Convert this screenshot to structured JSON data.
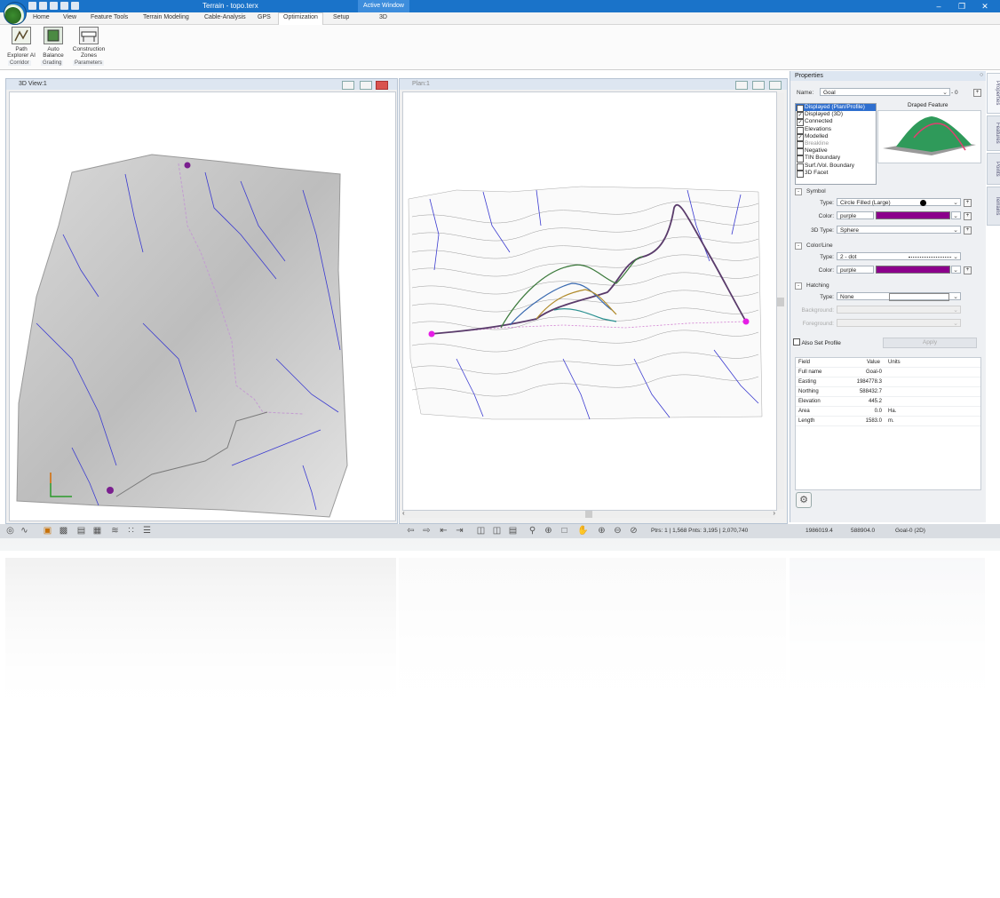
{
  "app": {
    "title": "Terrain - topo.terx",
    "active_window_label": "Active Window",
    "context_tab": "3D",
    "accent": "#1a73c9"
  },
  "menu": [
    "Home",
    "View",
    "Feature Tools",
    "Terrain Modeling",
    "Cable-Analysis",
    "GPS",
    "Optimization",
    "Setup"
  ],
  "menu_active": "Optimization",
  "ribbon": {
    "buttons": [
      {
        "label": "Path Explorer AI",
        "line1": "Path",
        "line2": "Explorer AI",
        "icon": "path-explorer-icon"
      },
      {
        "label": "Auto Balance",
        "line1": "Auto",
        "line2": "Balance",
        "icon": "auto-balance-icon"
      },
      {
        "label": "Construction Zones",
        "line1": "Construction",
        "line2": "Zones",
        "icon": "construction-zones-icon"
      }
    ],
    "groups": [
      "Corridor",
      "Grading",
      "Parameters"
    ]
  },
  "view3d": {
    "title": "3D View:1"
  },
  "plan": {
    "title": "Plan:1"
  },
  "status": {
    "counts": "Ptrs: 1 | 1,568  Pnts: 3,195 | 2,070,740",
    "easting": "1986019.4",
    "northing": "588904.0",
    "feature": "Goal-0 (2D)"
  },
  "properties": {
    "title": "Properties",
    "name_label": "Name:",
    "name_value": "Goal",
    "name_suffix": "- 0",
    "preview_label": "Draped Feature",
    "checks": [
      {
        "label": "Displayed (Plan/Profile)",
        "checked": true,
        "selected": true
      },
      {
        "label": "Displayed (3D)",
        "checked": true
      },
      {
        "label": "Connected",
        "checked": true
      },
      {
        "label": "Elevations",
        "checked": false
      },
      {
        "label": "Modelled",
        "checked": true
      },
      {
        "label": "Breakline",
        "checked": false,
        "dim": true
      },
      {
        "label": "Negative",
        "checked": false
      },
      {
        "label": "TIN Boundary",
        "checked": false
      },
      {
        "label": "Surf./Vol. Boundary",
        "checked": false
      },
      {
        "label": "3D Facet",
        "checked": false
      }
    ],
    "symbol": {
      "section": "Symbol",
      "type_label": "Type:",
      "type_value": "Circle Filled (Large)",
      "color_label": "Color:",
      "color_value": "purple",
      "color_hex": "#8b008b",
      "type3d_label": "3D Type:",
      "type3d_value": "Sphere"
    },
    "colorline": {
      "section": "Color/Line",
      "type_label": "Type:",
      "type_value": "2 - dot",
      "color_label": "Color:",
      "color_value": "purple"
    },
    "hatching": {
      "section": "Hatching",
      "type_label": "Type:",
      "type_value": "None",
      "background_label": "Background:",
      "foreground_label": "Foreground:"
    },
    "also_set_profile": "Also Set Profile",
    "apply": "Apply",
    "table": {
      "headers": [
        "Field",
        "Value",
        "Units"
      ],
      "rows": [
        [
          "Full name",
          "Goal-0",
          ""
        ],
        [
          "Easting",
          "1984778.3",
          ""
        ],
        [
          "Northing",
          "588432.7",
          ""
        ],
        [
          "Elevation",
          "445.2",
          ""
        ],
        [
          "Area",
          "0.0",
          "Ha."
        ],
        [
          "Length",
          "1583.0",
          "m."
        ]
      ]
    }
  },
  "side_tabs": [
    "Properties",
    "Features",
    "Points",
    "Terrains"
  ]
}
